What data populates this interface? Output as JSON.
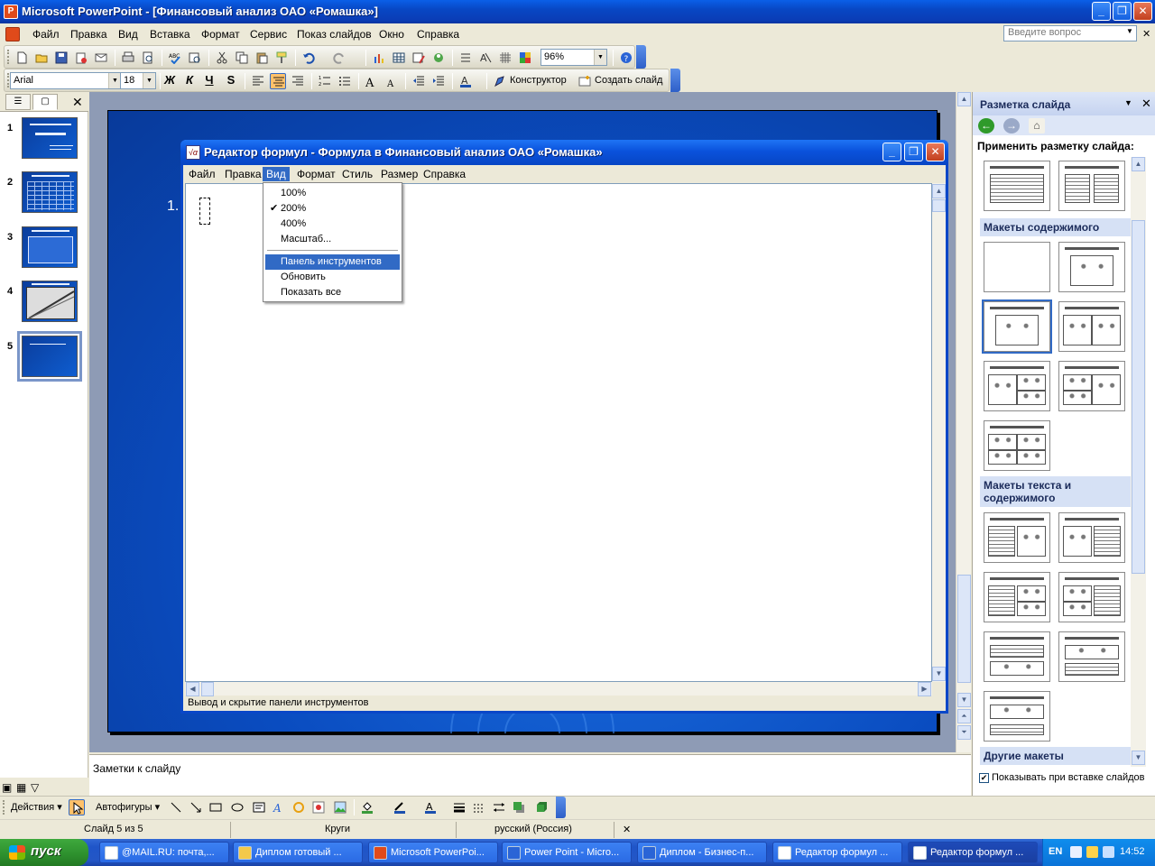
{
  "app": {
    "title": "Microsoft PowerPoint - [Финансовый анализ ОАО «Ромашка»]"
  },
  "menu": {
    "items": [
      "Файл",
      "Правка",
      "Вид",
      "Вставка",
      "Формат",
      "Сервис",
      "Показ слайдов",
      "Окно",
      "Справка"
    ]
  },
  "ask": {
    "placeholder": "Введите вопрос"
  },
  "toolbar": {
    "zoom": "96%",
    "font": "Arial",
    "size": "18",
    "bold": "Ж",
    "italic": "К",
    "underline": "Ч",
    "shadow": "S",
    "designer": "Конструктор",
    "new_slide": "Создать слайд"
  },
  "slides": {
    "numbers": [
      "1",
      "2",
      "3",
      "4",
      "5"
    ],
    "current_number": "1."
  },
  "notes": {
    "placeholder": "Заметки к слайду"
  },
  "formula_editor": {
    "title": "Редактор формул - Формула в Финансовый анализ ОАО «Ромашка»",
    "menu": [
      "Файл",
      "Правка",
      "Вид",
      "Формат",
      "Стиль",
      "Размер",
      "Справка"
    ],
    "dropdown": {
      "zoom_items": [
        "100%",
        "200%",
        "400%",
        "Масштаб..."
      ],
      "checked": "200%",
      "other_items": [
        "Панель инструментов",
        "Обновить",
        "Показать все"
      ],
      "highlighted": "Панель инструментов"
    },
    "status": "Вывод и скрытие панели инструментов"
  },
  "task_pane": {
    "title": "Разметка слайда",
    "apply_label": "Применить разметку слайда:",
    "sections": [
      "Макеты содержимого",
      "Макеты текста и содержимого",
      "Другие макеты"
    ],
    "checkbox_label": "Показывать при вставке слайдов"
  },
  "draw": {
    "actions": "Действия",
    "autoshapes": "Автофигуры"
  },
  "status": {
    "slide": "Слайд 5 из 5",
    "design": "Круги",
    "language": "русский (Россия)"
  },
  "taskbar": {
    "start": "пуск",
    "tasks": [
      "@MAIL.RU: почта,...",
      "Диплом готовый ...",
      "Microsoft PowerPoi...",
      "Power Point - Micro...",
      "Диплом - Бизнес-п...",
      "Редактор формул ...",
      "Редактор формул ..."
    ],
    "lang": "EN",
    "time": "14:52"
  },
  "colors": {
    "xp_blue": "#0a47c8",
    "highlight": "#316ac5",
    "slide_bg": "#0a4cc0"
  }
}
